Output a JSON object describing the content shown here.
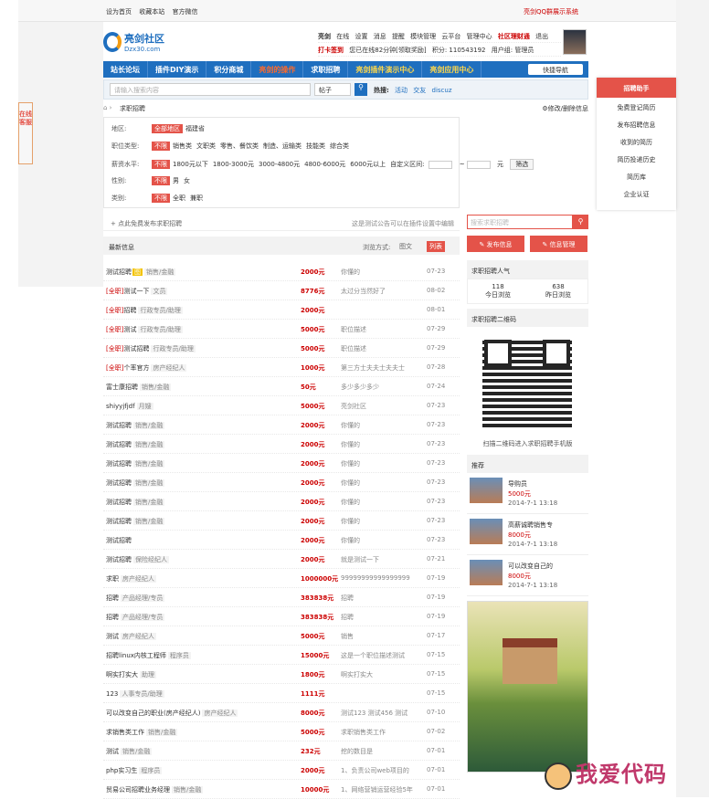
{
  "topbar": {
    "links": [
      "设为首页",
      "收藏本站",
      "官方微信"
    ],
    "right": "亮剑QQ群展示系统"
  },
  "logo": {
    "name": "亮剑社区",
    "domain": "Dzx30.com"
  },
  "user": {
    "line1": [
      "亮剑",
      "在线",
      "设置",
      "消息",
      "提醒",
      "模块管理",
      "云平台",
      "管理中心",
      "社区理财通",
      "退出"
    ],
    "checkin": "打卡签到",
    "checkin_note": "您已在线82分钟[领取奖励]",
    "points": "积分: 110543192",
    "group": "用户组: 管理员"
  },
  "nav": {
    "items": [
      "站长论坛",
      "插件DIY演示",
      "积分商城",
      "亮剑的操作",
      "求职招聘",
      "亮剑插件演示中心",
      "亮剑应用中心"
    ],
    "quick": "快捷导航"
  },
  "search": {
    "placeholder": "请输入搜索内容",
    "type": "帖子",
    "hot_label": "热搜:",
    "hot": [
      "活动",
      "交友",
      "discuz"
    ]
  },
  "crumb": {
    "title": "求职招聘",
    "right": "修改/删除信息"
  },
  "filters": [
    {
      "k": "地区:",
      "tag": "全部地区",
      "opts": [
        "福建省"
      ]
    },
    {
      "k": "职位类型:",
      "tag": "不限",
      "opts": [
        "销售类",
        "文职类",
        "零售、餐饮类",
        "制造、运输类",
        "技能类",
        "综合类"
      ]
    },
    {
      "k": "薪资水平:",
      "tag": "不限",
      "opts": [
        "1800元以下",
        "1800-3000元",
        "3000-4800元",
        "4800-6000元",
        "6000元以上",
        "自定义区间:"
      ],
      "unit": "元",
      "btn": "筛选"
    },
    {
      "k": "性别:",
      "tag": "不限",
      "opts": [
        "男",
        "女"
      ]
    },
    {
      "k": "类别:",
      "tag": "不限",
      "opts": [
        "全职",
        "兼职"
      ]
    }
  ],
  "postbar": {
    "left": "点此免费发布求职招聘",
    "right": "这是测试公告可以在插件设置中编辑"
  },
  "listhead": {
    "title": "最新信息",
    "mode": "浏览方式:",
    "b1": "图文",
    "b2": "列表"
  },
  "rows": [
    {
      "p": "",
      "t": "测试招聘",
      "ico": "图",
      "cat": "销售/金融",
      "s": "2000元",
      "d": "你懂的",
      "dt": "07-23"
    },
    {
      "p": "[全职]",
      "t": "测试一下",
      "cat": "文员",
      "s": "8776元",
      "d": "太过分当然好了",
      "dt": "08-02"
    },
    {
      "p": "[全职]",
      "t": "招聘",
      "cat": "行政专员/助理",
      "s": "2000元",
      "d": "",
      "dt": "08-01"
    },
    {
      "p": "[全职]",
      "t": "测试",
      "cat": "行政专员/助理",
      "s": "5000元",
      "d": "职位描述",
      "dt": "07-29"
    },
    {
      "p": "[全职]",
      "t": "测试招聘",
      "cat": "行政专员/助理",
      "s": "5000元",
      "d": "职位描述",
      "dt": "07-29"
    },
    {
      "p": "[全职]",
      "t": "个率官方",
      "cat": "房产经纪人",
      "s": "1000元",
      "d": "第三方士夫夫士夫夫士",
      "dt": "07-28"
    },
    {
      "p": "",
      "t": "富士康招聘",
      "cat": "销售/金融",
      "s": "50元",
      "d": "多少多少多少",
      "dt": "07-24"
    },
    {
      "p": "",
      "t": "shiyyjfjdf",
      "cat": "月嫂",
      "s": "5000元",
      "d": "亮剑社区",
      "dt": "07-23"
    },
    {
      "p": "",
      "t": "测试招聘",
      "cat": "销售/金融",
      "s": "2000元",
      "d": "你懂的",
      "dt": "07-23"
    },
    {
      "p": "",
      "t": "测试招聘",
      "cat": "销售/金融",
      "s": "2000元",
      "d": "你懂的",
      "dt": "07-23"
    },
    {
      "p": "",
      "t": "测试招聘",
      "cat": "销售/金融",
      "s": "2000元",
      "d": "你懂的",
      "dt": "07-23"
    },
    {
      "p": "",
      "t": "测试招聘",
      "cat": "销售/金融",
      "s": "2000元",
      "d": "你懂的",
      "dt": "07-23"
    },
    {
      "p": "",
      "t": "测试招聘",
      "cat": "销售/金融",
      "s": "2000元",
      "d": "你懂的",
      "dt": "07-23"
    },
    {
      "p": "",
      "t": "测试招聘",
      "cat": "销售/金融",
      "s": "2000元",
      "d": "你懂的",
      "dt": "07-23"
    },
    {
      "p": "",
      "t": "测试招聘",
      "cat": "",
      "s": "2000元",
      "d": "你懂的",
      "dt": "07-23"
    },
    {
      "p": "",
      "t": "测试招聘",
      "cat": "保险经纪人",
      "s": "2000元",
      "d": "就是测试一下",
      "dt": "07-21"
    },
    {
      "p": "",
      "t": "求职",
      "cat": "房产经纪人",
      "s": "1000000元",
      "d": "99999999999999999",
      "dt": "07-19"
    },
    {
      "p": "",
      "t": "招聘",
      "cat": "产品经理/专员",
      "s": "383838元",
      "d": "招聘",
      "dt": "07-19"
    },
    {
      "p": "",
      "t": "招聘",
      "cat": "产品经理/专员",
      "s": "383838元",
      "d": "招聘",
      "dt": "07-19"
    },
    {
      "p": "",
      "t": "测试",
      "cat": "房产经纪人",
      "s": "5000元",
      "d": "销售",
      "dt": "07-17"
    },
    {
      "p": "",
      "t": "招聘linux内核工程师",
      "cat": "程序员",
      "s": "15000元",
      "d": "这是一个职位描述测试",
      "dt": "07-15"
    },
    {
      "p": "",
      "t": "啊实打实大",
      "cat": "助理",
      "s": "1800元",
      "d": "啊实打实大",
      "dt": "07-15"
    },
    {
      "p": "",
      "t": "123",
      "cat": "人事专员/助理",
      "s": "1111元",
      "d": "",
      "dt": "07-15"
    },
    {
      "p": "",
      "t": "可以改变自己的职业(房产经纪人)",
      "cat": "房产经纪人",
      "s": "8000元",
      "d": "测试123 测试456 测试",
      "dt": "07-10"
    },
    {
      "p": "",
      "t": "求销售类工作",
      "cat": "销售/金融",
      "s": "5000元",
      "d": "求职销售类工作",
      "dt": "07-02"
    },
    {
      "p": "",
      "t": "测试",
      "cat": "销售/金融",
      "s": "232元",
      "d": "挖的数目是",
      "dt": "07-01"
    },
    {
      "p": "",
      "t": "php实习生",
      "cat": "程序员",
      "s": "2000元",
      "d": "1、负责公司web项目的",
      "dt": "07-01"
    },
    {
      "p": "",
      "t": "贸易公司招聘业务经理",
      "cat": "销售/金融",
      "s": "10000元",
      "d": "1、网络营销运营经验5年",
      "dt": "07-01"
    }
  ],
  "side": {
    "search": "搜索求职招聘",
    "publish": "发布信息",
    "manage": "信息管理",
    "pop": "求职招聘人气",
    "today_n": "118",
    "today": "今日浏览",
    "yest_n": "638",
    "yest": "昨日浏览",
    "qr": "求职招聘二维码",
    "qrcap": "扫描二维码进入求职招聘手机版",
    "rec": "推荐",
    "recs": [
      {
        "t": "导购员",
        "p": "5000元",
        "d": "2014-7-1 13:18"
      },
      {
        "t": "高薪诚聘销售专",
        "p": "8000元",
        "d": "2014-7-1 13:18"
      },
      {
        "t": "可以改变自己的",
        "p": "8000元",
        "d": "2014-7-1 13:18"
      }
    ]
  },
  "panel": {
    "title": "招聘助手",
    "items": [
      "免费登记简历",
      "发布招聘信息",
      "收到的简历",
      "简历投递历史",
      "简历库",
      "企业认证"
    ]
  },
  "kefu": "在线客服",
  "watermark": "我爱代码"
}
